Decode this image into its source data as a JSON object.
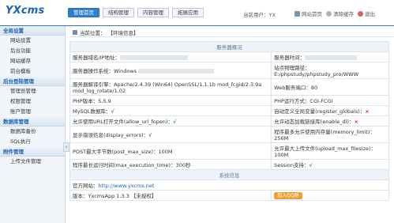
{
  "header": {
    "logo": "YXcms",
    "tabs": [
      "管理首页",
      "结构管理",
      "内容管理",
      "拓展应用"
    ],
    "user_label": "当前用户：",
    "user_name": "YX",
    "links": {
      "home": "网站首页",
      "clear": "清除缓存",
      "quit": "退出"
    }
  },
  "sidebar": {
    "sections": [
      {
        "title": "全局设置",
        "items": [
          "网站设置",
          "后台功能",
          "网站缓存",
          "前台模板"
        ]
      },
      {
        "title": "后台登陆管理",
        "items": [
          "管理员管理",
          "权限管理",
          "账户管理"
        ]
      },
      {
        "title": "数据库管理",
        "items": [
          "数据库备份",
          "SQL执行"
        ]
      },
      {
        "title": "附件管理",
        "items": [
          "上传文件管理"
        ]
      }
    ],
    "collapse_icon": "‹"
  },
  "main": {
    "breadcrumb_label": "当前位置：",
    "breadcrumb_value": "【环境信息】",
    "server_title": "服务器概况",
    "system_title": "系统信息",
    "rows": [
      {
        "l": "服务器域名/IP地址：",
        "lv": "",
        "r": "服务器时间：",
        "rv": ""
      },
      {
        "l": "服务器操作系统：",
        "lv": "Windows",
        "r": "站点物理路径：",
        "rv": "E:/phpstudy/phpstudy_pro/WWW"
      },
      {
        "l": "服务器解译引擎：",
        "lv": "Apache/2.4.39 (Win64) OpenSSL/1.1.1b mod_fcgid/2.3.9a mod_log_rotate/1.02",
        "r": "Web服务端口：",
        "rv": "80"
      },
      {
        "l": "PHP版本：",
        "lv": "5.5.9",
        "r": "PHP运行方式：",
        "rv": "CGI-FCGI"
      },
      {
        "l": "MySQL数据库：",
        "lv": "√",
        "r": "自动定义全局变量(register_globals)：",
        "rv": "×"
      },
      {
        "l": "允许使用URL打开文件(allow_url_fopen)：",
        "lv": "√",
        "r": "允许动态加载链接库(enable_dl)：",
        "rv": "×"
      },
      {
        "l": "显示错误信息(display_errors)：",
        "lv": "√",
        "r": "程序最多允许使用内存量(memory_limit)：",
        "rv": "256M"
      },
      {
        "l": "POST最大字节数(post_max_size)：",
        "lv": "100M",
        "r": "允许最大上传文件(upload_max_filesize)：",
        "rv": "100M"
      },
      {
        "l": "程序最长运行时间(max_execution_time)：",
        "lv": "300秒",
        "r": "Session支持：",
        "rv": "√"
      }
    ],
    "website_label": "官方网站：",
    "website_url": "http://www.yxcms.net",
    "version_label": "版本：",
    "version_value": "YxcmsApp 1.3.3 【未授权】",
    "qq_button": "加入QQ群"
  }
}
